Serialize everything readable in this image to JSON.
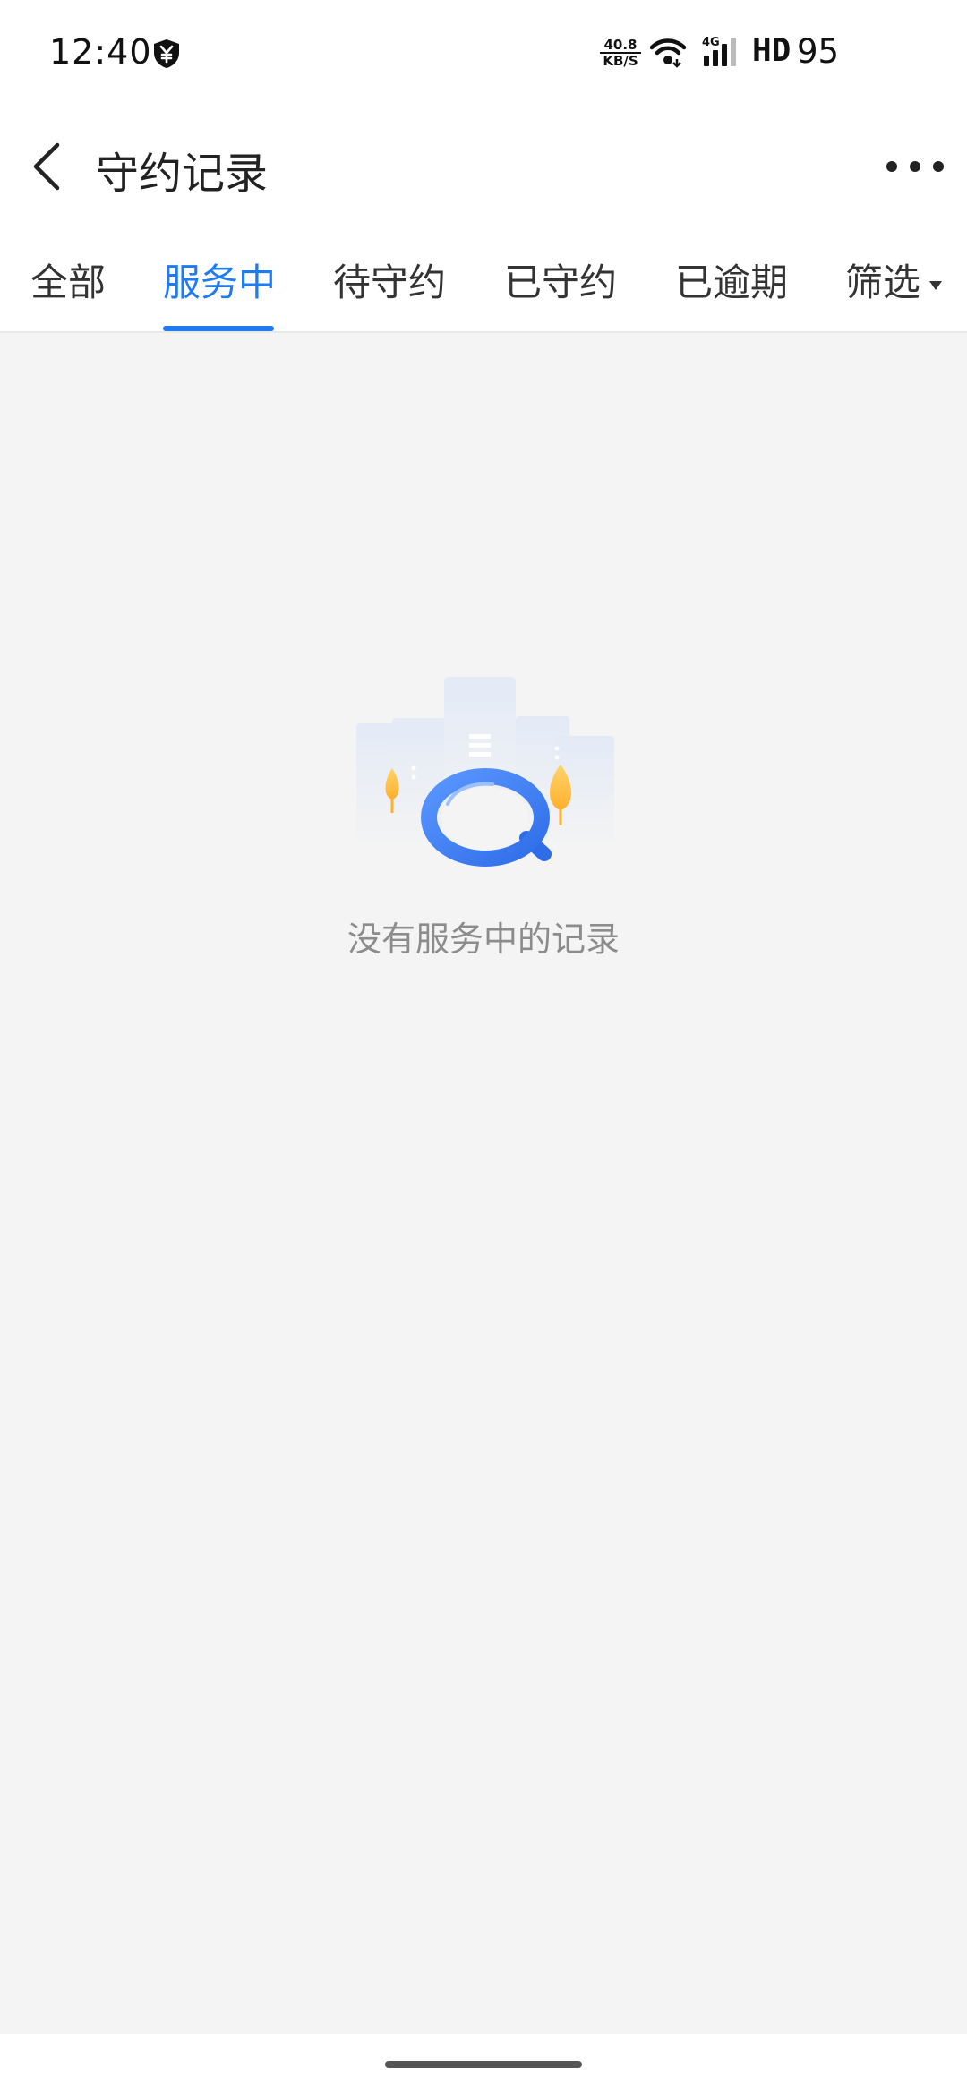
{
  "status_bar": {
    "time": "12:40",
    "net_speed_value": "40.8",
    "net_speed_unit": "KB/S",
    "network_type": "4G",
    "hd_label": "HD",
    "battery": "95",
    "shield_icon": "yuan-shield-icon",
    "wifi_icon": "wifi-icon",
    "signal_icon": "signal-bars-icon"
  },
  "header": {
    "title": "守约记录",
    "back_icon": "chevron-left-icon",
    "more_icon": "more-dots-icon"
  },
  "tabs": [
    {
      "label": "全部",
      "active": false
    },
    {
      "label": "服务中",
      "active": true
    },
    {
      "label": "待守约",
      "active": false
    },
    {
      "label": "已守约",
      "active": false
    },
    {
      "label": "已逾期",
      "active": false
    }
  ],
  "filter": {
    "label": "筛选",
    "icon": "caret-down-icon"
  },
  "empty_state": {
    "icon": "magnifier-illustration",
    "message": "没有服务中的记录"
  },
  "colors": {
    "accent": "#1f7bf2",
    "background": "#f4f4f4",
    "tree": "#ffc24a"
  }
}
